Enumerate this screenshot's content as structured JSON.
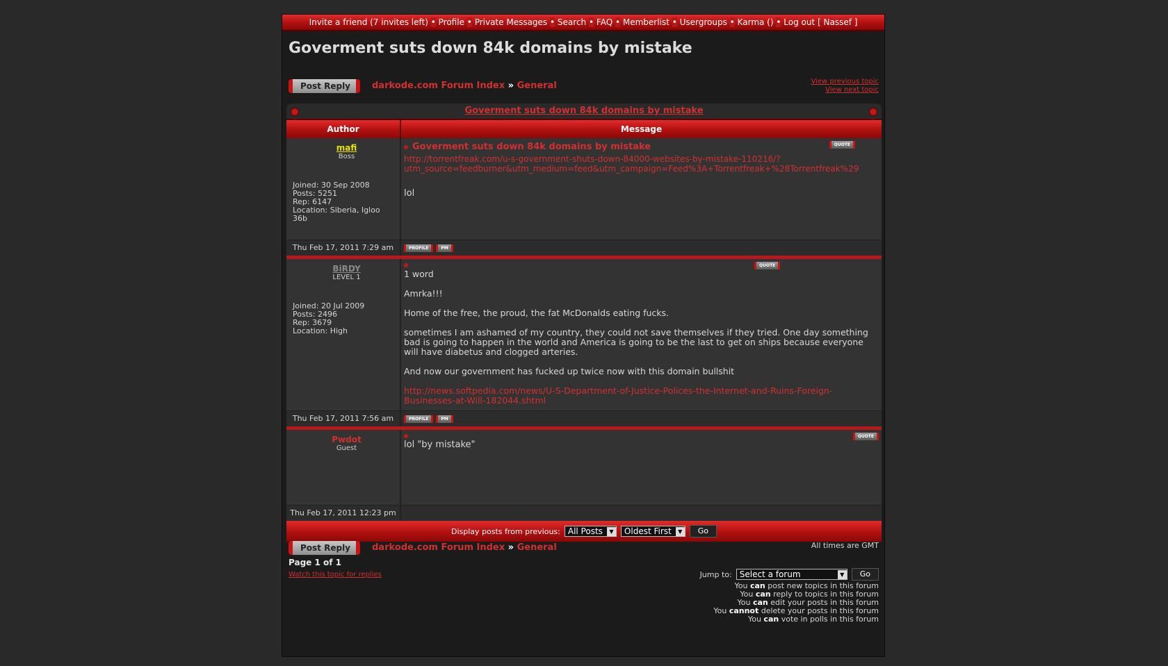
{
  "topnav": {
    "invite": "Invite a friend (7 invites left)",
    "profile": "Profile",
    "pm": "Private Messages",
    "search": "Search",
    "faq": "FAQ",
    "memberlist": "Memberlist",
    "usergroups": "Usergroups",
    "karma": "Karma ()",
    "logout": "Log out [ Nassef ]",
    "sep": "•"
  },
  "page_title": "Goverment suts down 84k domains by mistake",
  "post_reply": "Post Reply",
  "breadcrumb": {
    "index": "darkode.com Forum Index",
    "arrow": "»",
    "forum": "General"
  },
  "topic_nav": {
    "prev": "View previous topic",
    "next": "View next topic"
  },
  "table": {
    "title": "Goverment suts down 84k domains by mistake",
    "col_author": "Author",
    "col_message": "Message"
  },
  "posts": [
    {
      "author": "mafi",
      "rank": "Boss",
      "joined": "Joined: 30 Sep 2008",
      "posts": "Posts: 5251",
      "rep": "Rep: 6147",
      "location": "Location: Siberia, Igloo 36b",
      "title": "Goverment suts down 84k domains by mistake",
      "link1": "http://torrentfreak.com/u-s-government-shuts-down-84000-websites-by-mistake-110216/?",
      "link2": "utm_source=feedburner&utm_medium=feed&utm_campaign=Feed%3A+Torrentfreak+%28Torrentfreak%29",
      "body": "lol",
      "date": "Thu Feb 17, 2011 7:29 am"
    },
    {
      "author": "BiRDY",
      "rank": "LEVEL 1",
      "joined": "Joined: 20 Jul 2009",
      "posts": "Posts: 2496",
      "rep": "Rep: 3679",
      "location": "Location: High",
      "p1": "1 word",
      "p2": "Amrka!!!",
      "p3": "Home of the free, the proud, the fat McDonalds eating fucks.",
      "p4": "sometimes I am ashamed of my country, they could not save themselves if they tried. One day something bad is going to happen in the world and America is going to be the last to get on ships because everyone will have diabetus and clogged arteries.",
      "p5": "And now our government has fucked up twice now with this domain bullshit",
      "link": "http://news.softpedia.com/news/U-S-Department-of-Justice-Polices-the-Internet-and-Ruins-Foreign-Businesses-at-Will-182044.shtml",
      "date": "Thu Feb 17, 2011 7:56 am"
    },
    {
      "author": "Pwdot",
      "rank": "Guest",
      "body": "lol \"by mistake\"",
      "date": "Thu Feb 17, 2011 12:23 pm"
    }
  ],
  "buttons": {
    "quote": "QUOTE",
    "profile": "PROFILE",
    "pm": "PM"
  },
  "display": {
    "label": "Display posts from previous:",
    "range": "All Posts",
    "order": "Oldest First",
    "go": "Go"
  },
  "timezone": "All times are GMT",
  "pagination": "Page 1 of 1",
  "watch": "Watch this topic for replies",
  "jump": {
    "label": "Jump to:",
    "select": "Select a forum",
    "go": "Go"
  },
  "permissions": [
    {
      "pre": "You ",
      "word": "can",
      "post": " post new topics in this forum"
    },
    {
      "pre": "You ",
      "word": "can",
      "post": " reply to topics in this forum"
    },
    {
      "pre": "You ",
      "word": "can",
      "post": " edit your posts in this forum"
    },
    {
      "pre": "You ",
      "word": "cannot",
      "post": " delete your posts in this forum"
    },
    {
      "pre": "You ",
      "word": "can",
      "post": " vote in polls in this forum"
    }
  ],
  "colors": {
    "accent": "#d23030",
    "bar": "#b81818",
    "author1": "#e8e000",
    "author2": "#8a8a8a",
    "author3": "#d23030"
  }
}
